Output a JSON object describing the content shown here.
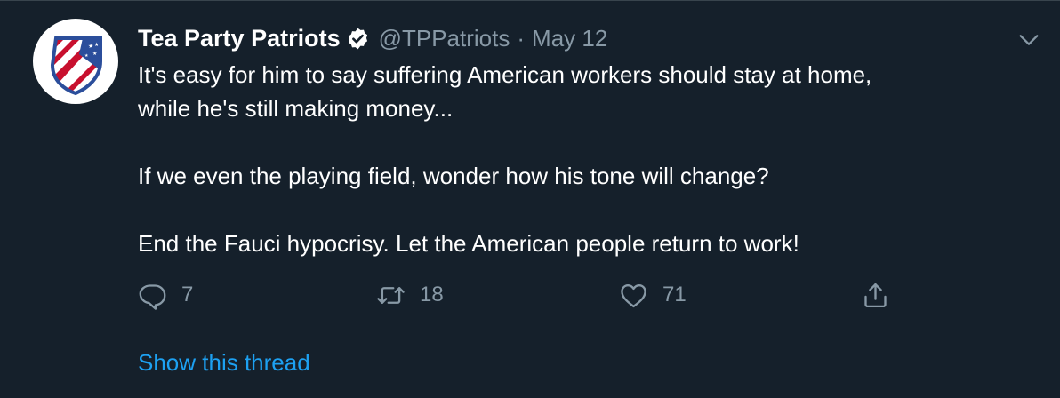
{
  "tweet": {
    "display_name": "Tea Party Patriots",
    "handle": "@TPPatriots",
    "separator": "·",
    "date": "May 12",
    "lines": [
      "It's easy for him to say suffering American workers should stay at home,",
      "while he's still making money...",
      "If we even the playing field, wonder how his tone will change?",
      "End the Fauci hypocrisy. Let the American people return to work!"
    ],
    "reply_count": "7",
    "retweet_count": "18",
    "like_count": "71",
    "show_thread": "Show this thread"
  },
  "icons": {
    "avatar": "shield-flag-logo",
    "verified": "verified-badge-icon",
    "menu": "chevron-down-icon",
    "reply": "reply-icon",
    "retweet": "retweet-icon",
    "like": "heart-icon",
    "share": "share-icon"
  },
  "colors": {
    "background": "#15202b",
    "text": "#ffffff",
    "secondary": "#8899a6",
    "link": "#1da1f2"
  }
}
